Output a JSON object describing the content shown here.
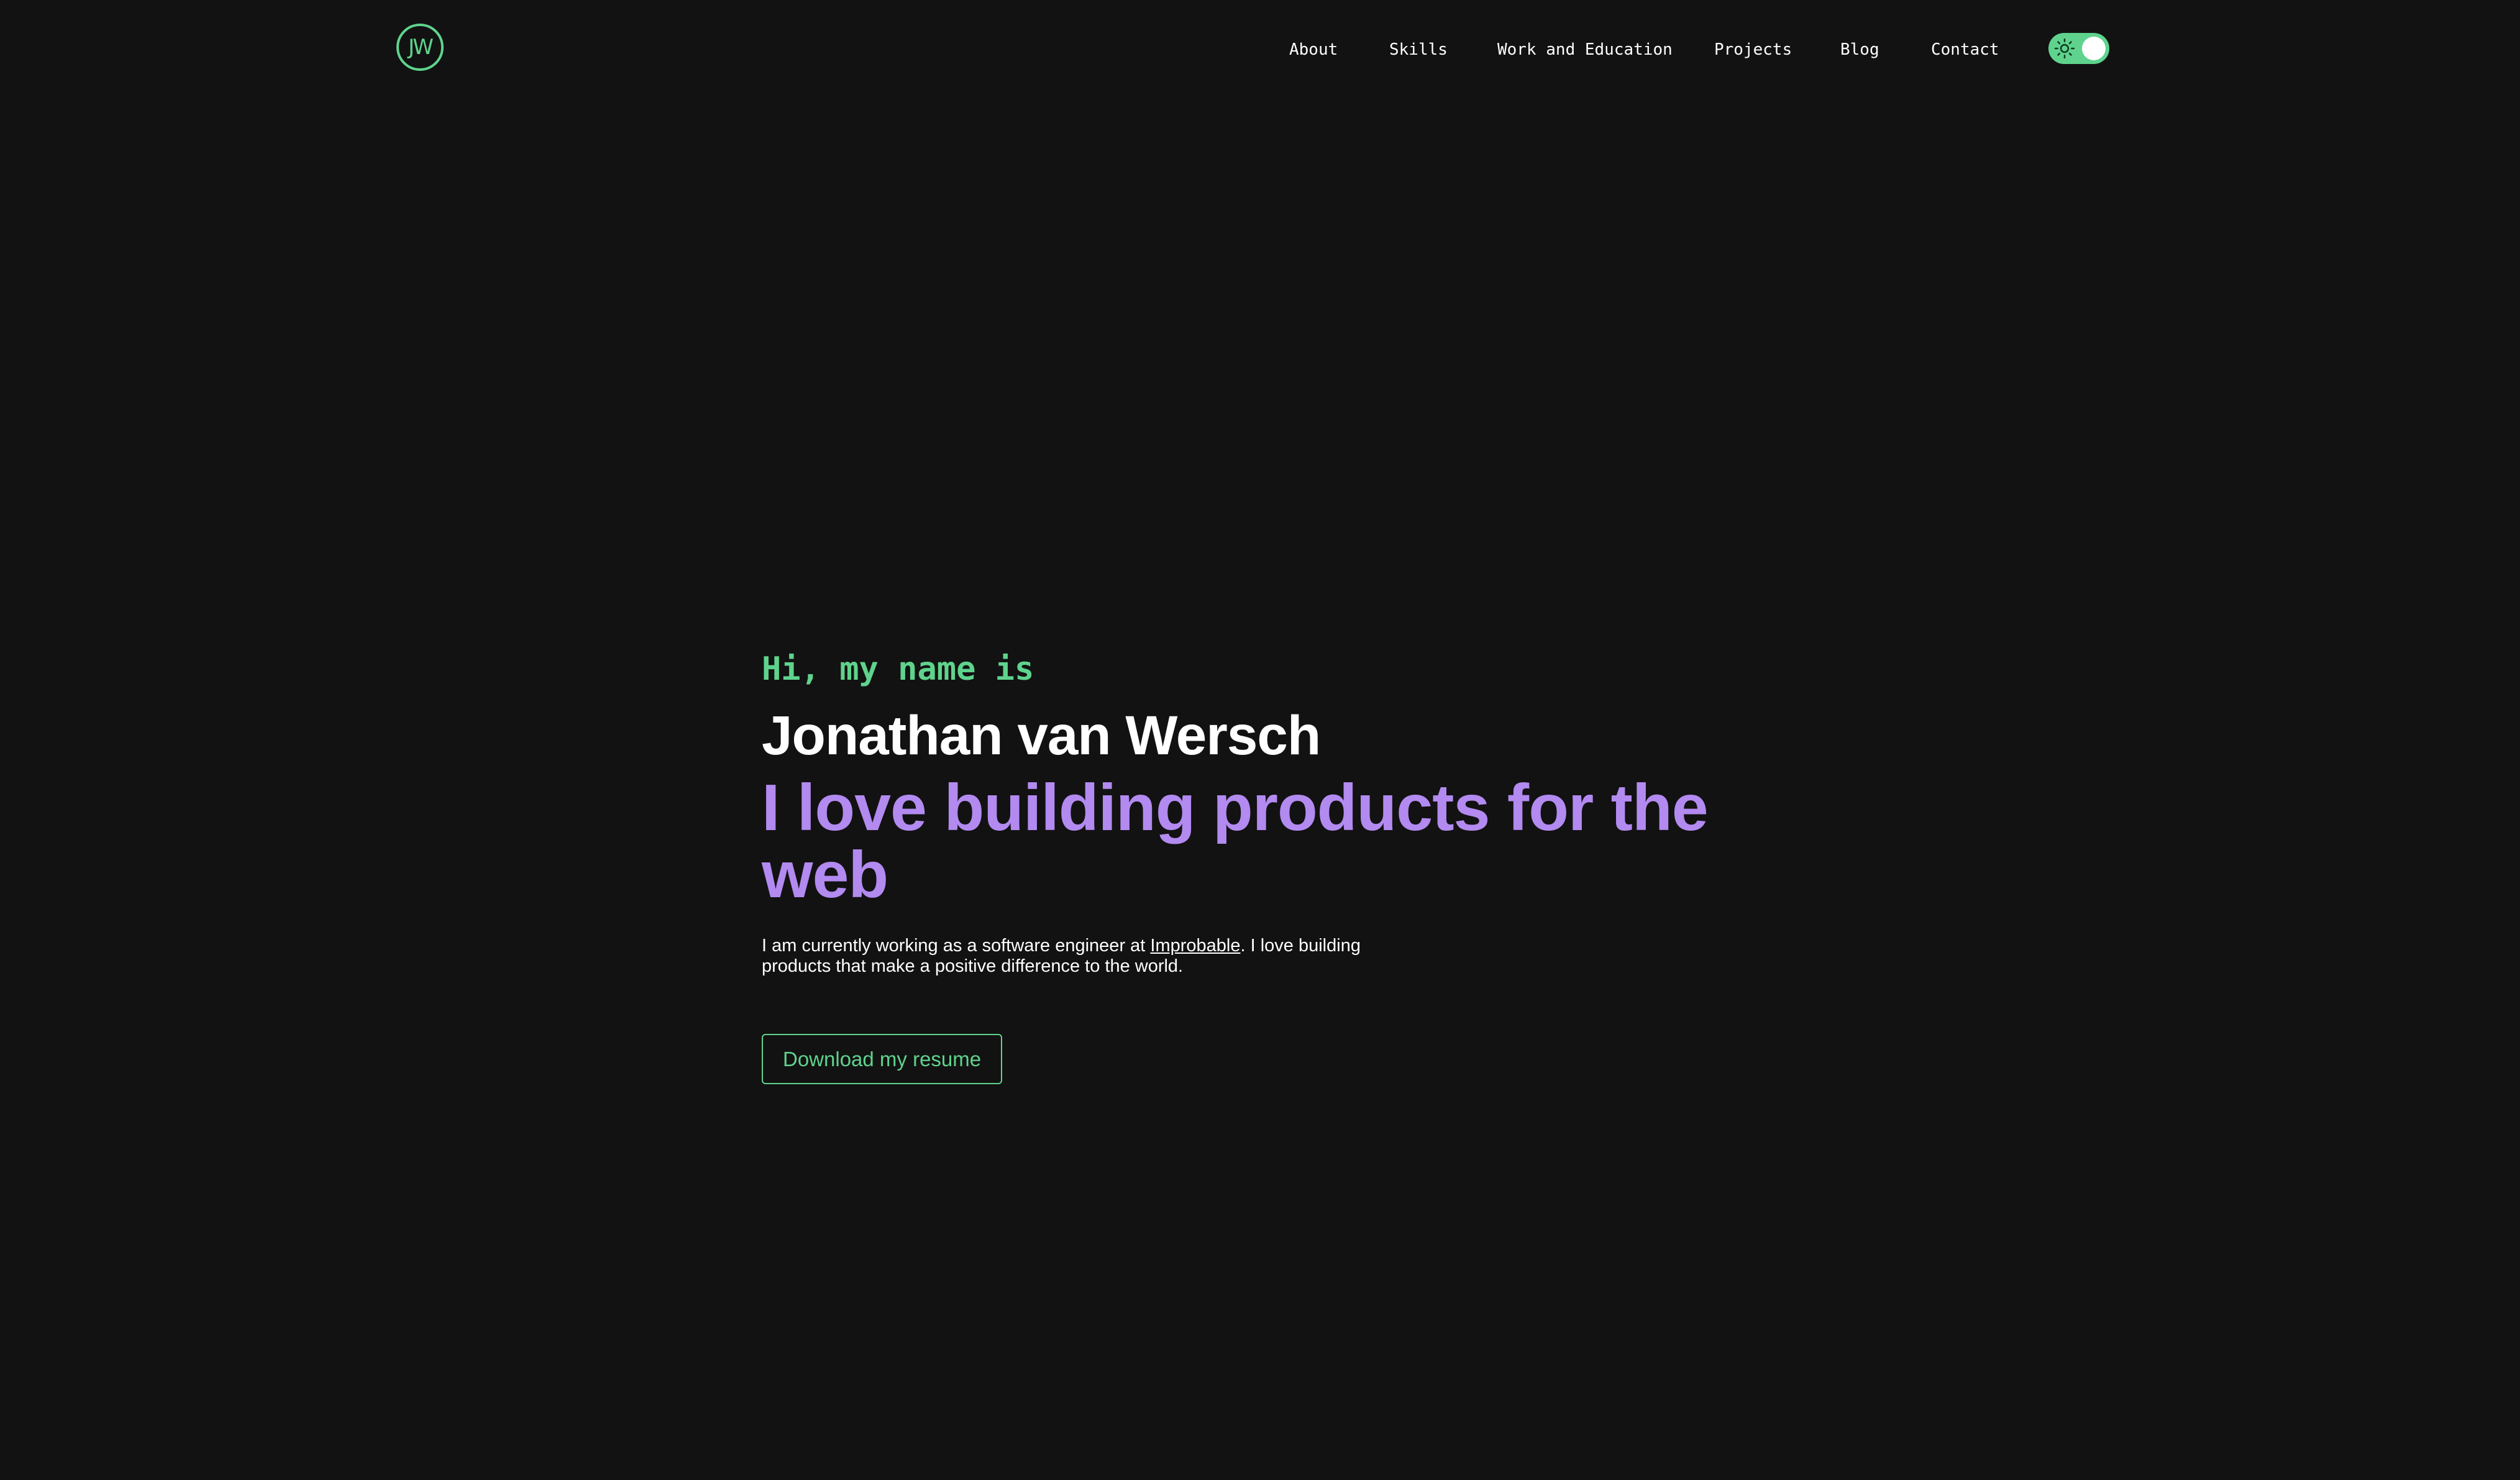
{
  "header": {
    "logo_text": "JW",
    "nav": [
      {
        "label": "About"
      },
      {
        "label": "Skills"
      },
      {
        "label": "Work and Education"
      },
      {
        "label": "Projects"
      },
      {
        "label": "Blog"
      },
      {
        "label": "Contact"
      }
    ],
    "theme_toggle": {
      "icon": "sun-icon",
      "state": "light-mode-toggle",
      "track_color": "#5fd38d"
    }
  },
  "hero": {
    "intro": "Hi, my name is",
    "name": "Jonathan van Wersch",
    "tagline": "I love building products for the web",
    "bio_before": "I am currently working as a software engineer at ",
    "bio_link": "Improbable",
    "bio_after": ". I love building products that make a positive difference to the world.",
    "resume_button": "Download my resume"
  },
  "colors": {
    "background": "#121212",
    "accent_green": "#5fd38d",
    "accent_purple": "#b28af0",
    "text": "#ffffff"
  }
}
